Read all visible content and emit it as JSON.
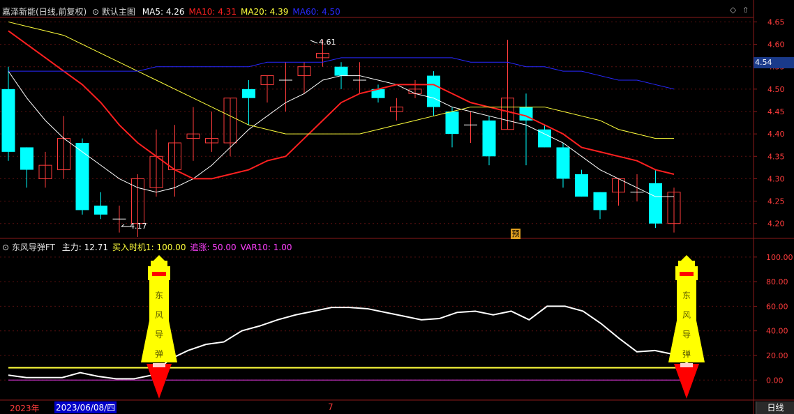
{
  "upper": {
    "stock_name": "嘉泽新能",
    "mode": "(日线,前复权)",
    "indicator_name": "默认主图",
    "ma": [
      {
        "label": "MA5:",
        "value": "4.26",
        "color": "#ffffff"
      },
      {
        "label": "MA10:",
        "value": "4.31",
        "color": "#ff2020"
      },
      {
        "label": "MA20:",
        "value": "4.39",
        "color": "#ffff3c"
      },
      {
        "label": "MA60:",
        "value": "4.50",
        "color": "#2828ff"
      }
    ],
    "price_tag": "4.54",
    "high_label": "4.61",
    "low_label": "4.17",
    "forecast_badge": "预"
  },
  "lower": {
    "indicator_name": "东风导弹FT",
    "fields": [
      {
        "label": "主力:",
        "value": "12.71",
        "color": "#ffffff"
      },
      {
        "label": "买入时机1:",
        "value": "100.00",
        "color": "#ffff3c"
      },
      {
        "label": "追涨:",
        "value": "50.00",
        "color": "#ff40ff"
      },
      {
        "label": "VAR10:",
        "value": "1.00",
        "color": "#ff40ff"
      }
    ],
    "missile_chars": [
      "东",
      "风",
      "导",
      "弹"
    ]
  },
  "footer": {
    "year": "2023年",
    "date": "2023/06/08/四",
    "month_marker": "7",
    "period_tab": "日线"
  },
  "chart_data": [
    {
      "type": "candlestick",
      "title": "嘉泽新能",
      "y_ticks": [
        "4.65",
        "4.60",
        "4.55",
        "4.50",
        "4.45",
        "4.40",
        "4.35",
        "4.30",
        "4.25",
        "4.20"
      ],
      "ylim": [
        4.17,
        4.66
      ],
      "up_color": "#ff3c3c",
      "down_color": "#00ffff",
      "candles": [
        {
          "o": 4.5,
          "h": 4.55,
          "l": 4.34,
          "c": 4.36
        },
        {
          "o": 4.37,
          "h": 4.37,
          "l": 4.28,
          "c": 4.32
        },
        {
          "o": 4.3,
          "h": 4.36,
          "l": 4.28,
          "c": 4.33
        },
        {
          "o": 4.32,
          "h": 4.44,
          "l": 4.3,
          "c": 4.39
        },
        {
          "o": 4.38,
          "h": 4.39,
          "l": 4.22,
          "c": 4.23
        },
        {
          "o": 4.24,
          "h": 4.27,
          "l": 4.21,
          "c": 4.22
        },
        {
          "o": 4.21,
          "h": 4.24,
          "l": 4.18,
          "c": 4.21
        },
        {
          "o": 4.2,
          "h": 4.31,
          "l": 4.17,
          "c": 4.3
        },
        {
          "o": 4.28,
          "h": 4.41,
          "l": 4.26,
          "c": 4.35
        },
        {
          "o": 4.32,
          "h": 4.42,
          "l": 4.26,
          "c": 4.38
        },
        {
          "o": 4.39,
          "h": 4.46,
          "l": 4.34,
          "c": 4.4
        },
        {
          "o": 4.38,
          "h": 4.45,
          "l": 4.36,
          "c": 4.39
        },
        {
          "o": 4.38,
          "h": 4.48,
          "l": 4.35,
          "c": 4.48
        },
        {
          "o": 4.5,
          "h": 4.52,
          "l": 4.42,
          "c": 4.48
        },
        {
          "o": 4.51,
          "h": 4.53,
          "l": 4.47,
          "c": 4.53
        },
        {
          "o": 4.52,
          "h": 4.56,
          "l": 4.45,
          "c": 4.52
        },
        {
          "o": 4.53,
          "h": 4.56,
          "l": 4.49,
          "c": 4.55
        },
        {
          "o": 4.57,
          "h": 4.61,
          "l": 4.55,
          "c": 4.58
        },
        {
          "o": 4.55,
          "h": 4.56,
          "l": 4.5,
          "c": 4.53
        },
        {
          "o": 4.52,
          "h": 4.56,
          "l": 4.49,
          "c": 4.52
        },
        {
          "o": 4.5,
          "h": 4.51,
          "l": 4.47,
          "c": 4.48
        },
        {
          "o": 4.45,
          "h": 4.48,
          "l": 4.43,
          "c": 4.46
        },
        {
          "o": 4.49,
          "h": 4.52,
          "l": 4.48,
          "c": 4.5
        },
        {
          "o": 4.53,
          "h": 4.54,
          "l": 4.44,
          "c": 4.46
        },
        {
          "o": 4.45,
          "h": 4.46,
          "l": 4.37,
          "c": 4.4
        },
        {
          "o": 4.42,
          "h": 4.45,
          "l": 4.38,
          "c": 4.42
        },
        {
          "o": 4.43,
          "h": 4.44,
          "l": 4.33,
          "c": 4.35
        },
        {
          "o": 4.41,
          "h": 4.61,
          "l": 4.41,
          "c": 4.48
        },
        {
          "o": 4.46,
          "h": 4.49,
          "l": 4.33,
          "c": 4.43
        },
        {
          "o": 4.41,
          "h": 4.42,
          "l": 4.37,
          "c": 4.37
        },
        {
          "o": 4.37,
          "h": 4.38,
          "l": 4.28,
          "c": 4.3
        },
        {
          "o": 4.31,
          "h": 4.32,
          "l": 4.26,
          "c": 4.26
        },
        {
          "o": 4.27,
          "h": 4.27,
          "l": 4.21,
          "c": 4.23
        },
        {
          "o": 4.27,
          "h": 4.3,
          "l": 4.24,
          "c": 4.3
        },
        {
          "o": 4.27,
          "h": 4.31,
          "l": 4.25,
          "c": 4.27
        },
        {
          "o": 4.29,
          "h": 4.32,
          "l": 4.19,
          "c": 4.2
        },
        {
          "o": 4.2,
          "h": 4.28,
          "l": 4.18,
          "c": 4.27
        }
      ],
      "series": [
        {
          "name": "MA5",
          "color": "#ffffff",
          "values": [
            4.54,
            4.48,
            4.43,
            4.39,
            4.36,
            4.33,
            4.3,
            4.28,
            4.27,
            4.28,
            4.3,
            4.33,
            4.37,
            4.41,
            4.44,
            4.47,
            4.49,
            4.52,
            4.53,
            4.53,
            4.52,
            4.51,
            4.49,
            4.48,
            4.46,
            4.45,
            4.44,
            4.43,
            4.42,
            4.4,
            4.38,
            4.35,
            4.32,
            4.3,
            4.28,
            4.26,
            4.26
          ]
        },
        {
          "name": "MA10",
          "color": "#ff2020",
          "values": [
            4.63,
            4.6,
            4.57,
            4.54,
            4.51,
            4.47,
            4.42,
            4.38,
            4.35,
            4.32,
            4.3,
            4.3,
            4.31,
            4.32,
            4.34,
            4.35,
            4.39,
            4.43,
            4.47,
            4.49,
            4.5,
            4.51,
            4.51,
            4.51,
            4.49,
            4.47,
            4.46,
            4.45,
            4.44,
            4.42,
            4.4,
            4.37,
            4.36,
            4.35,
            4.34,
            4.32,
            4.31
          ]
        },
        {
          "name": "MA20",
          "color": "#ffff3c",
          "values": [
            4.65,
            4.64,
            4.63,
            4.62,
            4.6,
            4.58,
            4.56,
            4.54,
            4.52,
            4.5,
            4.48,
            4.46,
            4.44,
            4.42,
            4.41,
            4.4,
            4.4,
            4.4,
            4.4,
            4.4,
            4.41,
            4.42,
            4.43,
            4.44,
            4.45,
            4.46,
            4.46,
            4.46,
            4.46,
            4.46,
            4.45,
            4.44,
            4.43,
            4.41,
            4.4,
            4.39,
            4.39
          ]
        },
        {
          "name": "MA60",
          "color": "#2828ff",
          "values": [
            4.54,
            4.54,
            4.54,
            4.54,
            4.54,
            4.54,
            4.54,
            4.54,
            4.55,
            4.55,
            4.55,
            4.55,
            4.55,
            4.55,
            4.56,
            4.56,
            4.56,
            4.56,
            4.57,
            4.57,
            4.57,
            4.57,
            4.57,
            4.57,
            4.57,
            4.56,
            4.56,
            4.56,
            4.55,
            4.55,
            4.54,
            4.54,
            4.53,
            4.52,
            4.52,
            4.51,
            4.5
          ]
        }
      ]
    },
    {
      "type": "line",
      "title": "东风导弹FT",
      "y_ticks": [
        "100.00",
        "80.00",
        "60.00",
        "40.00",
        "20.00",
        "0.00"
      ],
      "ylim": [
        -14,
        105
      ],
      "series": [
        {
          "name": "主力",
          "color": "#ffffff",
          "values": [
            4,
            2,
            2,
            2,
            6,
            3,
            1,
            1,
            4,
            17,
            24,
            29,
            31,
            40,
            44,
            49,
            53,
            56,
            59,
            59,
            58,
            55,
            52,
            49,
            50,
            55,
            56,
            53,
            56,
            49,
            60,
            60,
            56,
            46,
            34,
            23,
            24,
            21,
            12
          ]
        },
        {
          "name": "买入时机1",
          "color": "#ffff3c",
          "values": [
            10,
            10,
            10,
            10,
            10,
            10,
            10,
            10,
            10,
            10,
            10,
            10,
            10,
            10,
            10,
            10,
            10,
            10,
            10,
            10,
            10,
            10,
            10,
            10,
            10,
            10,
            10,
            10,
            10,
            10,
            10,
            10,
            10,
            10,
            10,
            10,
            10,
            10,
            10
          ]
        },
        {
          "name": "VAR10",
          "color": "#ff40ff",
          "values": [
            0,
            0,
            0,
            0,
            0,
            0,
            0,
            0,
            0,
            0,
            0,
            0,
            0,
            0,
            0,
            0,
            0,
            0,
            0,
            0,
            0,
            0,
            0,
            0,
            0,
            0,
            0,
            0,
            0,
            0,
            0,
            0,
            0,
            0,
            0,
            0,
            0,
            0,
            0
          ]
        }
      ],
      "signal_points": [
        8,
        37
      ]
    }
  ]
}
